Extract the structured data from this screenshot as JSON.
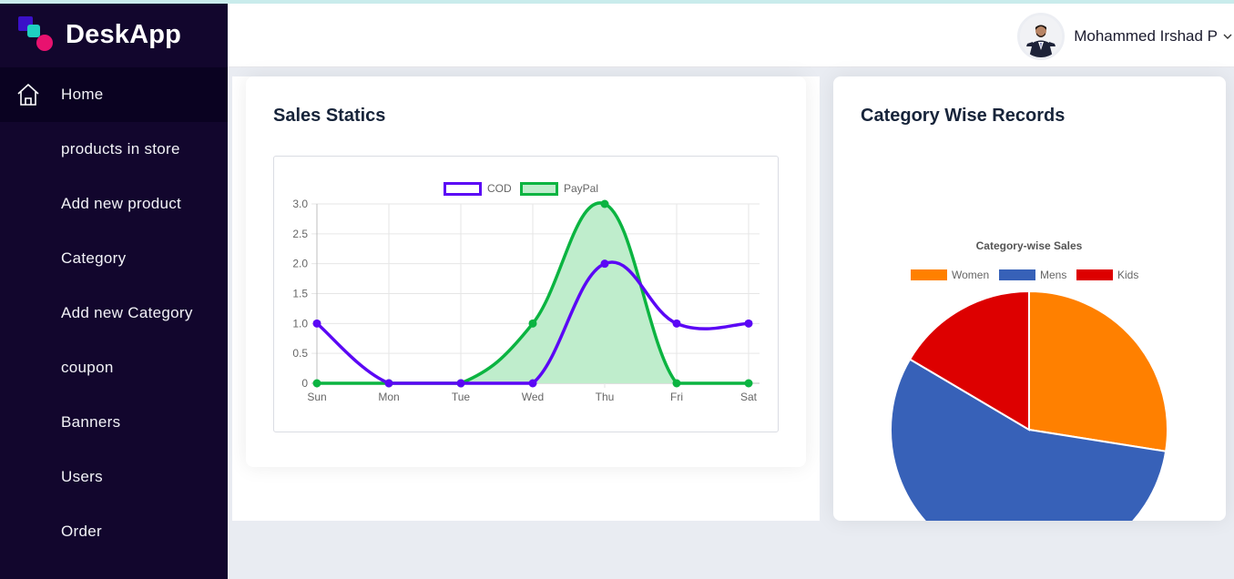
{
  "app": {
    "brand": "DeskApp"
  },
  "sidebar": {
    "items": [
      {
        "label": "Home",
        "active": true,
        "icon": "home-icon"
      },
      {
        "label": "products in store"
      },
      {
        "label": "Add new product"
      },
      {
        "label": "Category"
      },
      {
        "label": "Add new Category"
      },
      {
        "label": "coupon"
      },
      {
        "label": "Banners"
      },
      {
        "label": "Users"
      },
      {
        "label": "Order"
      }
    ]
  },
  "header": {
    "user_name": "Mohammed Irshad P",
    "dropdown_icon": "chevron-down-icon"
  },
  "sales_card": {
    "title": "Sales Statics"
  },
  "category_card": {
    "title": "Category Wise Records"
  },
  "colors": {
    "cod": "#5b07f5",
    "paypal": "#0bb441",
    "paypal_fill": "#bfedcc",
    "women": "#ff8000",
    "mens": "#3761b8",
    "kids": "#dd0000",
    "sidebar": "#12062d"
  },
  "chart_data": [
    {
      "type": "line",
      "categories": [
        "Sun",
        "Mon",
        "Tue",
        "Wed",
        "Thu",
        "Fri",
        "Sat"
      ],
      "series": [
        {
          "name": "COD",
          "values": [
            1,
            0,
            0,
            0,
            2,
            1,
            1
          ],
          "fill": false
        },
        {
          "name": "PayPal",
          "values": [
            0,
            0,
            0,
            1,
            3,
            0,
            0
          ],
          "fill": true
        }
      ],
      "ylim": [
        0,
        3
      ],
      "yticks": [
        "0",
        "0.5",
        "1.0",
        "1.5",
        "2.0",
        "2.5",
        "3.0"
      ],
      "grid": true,
      "legend": "top"
    },
    {
      "type": "pie",
      "title": "Category-wise Sales",
      "labels": [
        "Women",
        "Mens",
        "Kids"
      ],
      "values": [
        27.5,
        56,
        16.5
      ],
      "legend": "top"
    }
  ]
}
